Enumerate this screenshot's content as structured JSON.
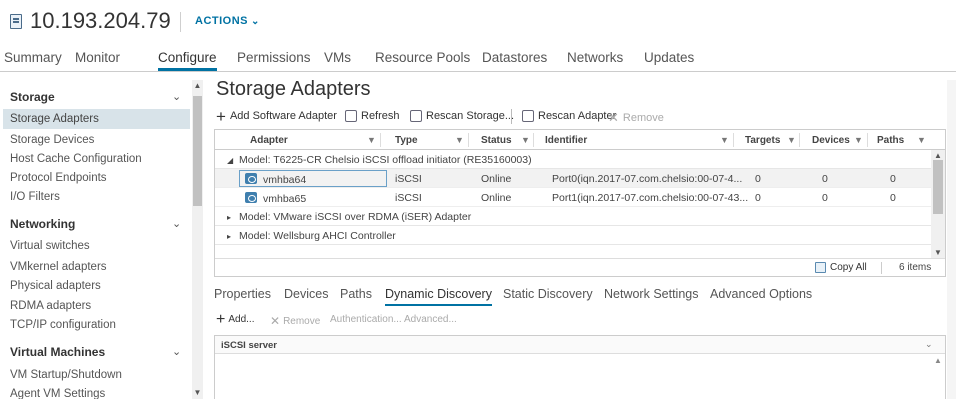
{
  "header": {
    "host_title": "10.193.204.79",
    "actions_label": "ACTIONS",
    "accent_color": "#0072a3"
  },
  "tabs": [
    {
      "label": "Summary"
    },
    {
      "label": "Monitor"
    },
    {
      "label": "Configure",
      "active": true
    },
    {
      "label": "Permissions"
    },
    {
      "label": "VMs"
    },
    {
      "label": "Resource Pools"
    },
    {
      "label": "Datastores"
    },
    {
      "label": "Networks"
    },
    {
      "label": "Updates"
    }
  ],
  "sidebar": {
    "storage": {
      "title": "Storage",
      "items": [
        "Storage Adapters",
        "Storage Devices",
        "Host Cache Configuration",
        "Protocol Endpoints",
        "I/O Filters"
      ]
    },
    "networking": {
      "title": "Networking",
      "items": [
        "Virtual switches",
        "VMkernel adapters",
        "Physical adapters",
        "RDMA adapters",
        "TCP/IP configuration"
      ]
    },
    "vms": {
      "title": "Virtual Machines",
      "items": [
        "VM Startup/Shutdown",
        "Agent VM Settings"
      ]
    }
  },
  "main": {
    "title": "Storage Adapters",
    "toolbar": {
      "add_software": "Add Software Adapter",
      "refresh": "Refresh",
      "rescan_storage": "Rescan Storage...",
      "rescan_adapter": "Rescan Adapter",
      "remove": "Remove"
    },
    "grid": {
      "columns": [
        "Adapter",
        "Type",
        "Status",
        "Identifier",
        "Targets",
        "Devices",
        "Paths"
      ],
      "groups": [
        "Model: T6225-CR Chelsio iSCSI offload initiator (RE35160003)",
        "Model: VMware iSCSI over RDMA (iSER) Adapter",
        "Model: Wellsburg AHCI Controller"
      ],
      "rows": [
        {
          "adapter": "vmhba64",
          "type": "iSCSI",
          "status": "Online",
          "identifier": "Port0(iqn.2017-07.com.chelsio:00-07-4...",
          "targets": "0",
          "devices": "0",
          "paths": "0"
        },
        {
          "adapter": "vmhba65",
          "type": "iSCSI",
          "status": "Online",
          "identifier": "Port1(iqn.2017-07.com.chelsio:00-07-43...",
          "targets": "0",
          "devices": "0",
          "paths": "0"
        }
      ],
      "copy_all": "Copy All",
      "item_count": "6 items"
    },
    "subtabs": [
      "Properties",
      "Devices",
      "Paths",
      "Dynamic Discovery",
      "Static Discovery",
      "Network Settings",
      "Advanced Options"
    ],
    "active_subtab": "Dynamic Discovery",
    "discovery_toolbar": {
      "add": "Add...",
      "remove": "Remove",
      "authentication": "Authentication...",
      "advanced": "Advanced..."
    },
    "discovery_grid": {
      "column": "iSCSI server"
    }
  }
}
